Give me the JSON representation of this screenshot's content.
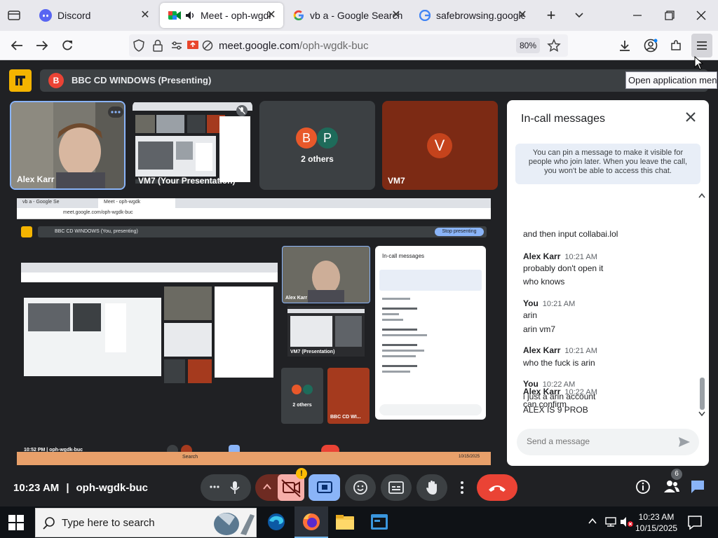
{
  "browser": {
    "tabs": [
      {
        "title": "Discord",
        "active": false
      },
      {
        "title": "Meet - oph-wgdk-buc",
        "active": true
      },
      {
        "title": "vb a - Google Search",
        "active": false
      },
      {
        "title": "safebrowsing.google.co",
        "active": false
      }
    ],
    "url_host": "meet.google.com",
    "url_path": "/oph-wgdk-buc",
    "zoom": "80%",
    "tooltip": "Open application menu"
  },
  "meet": {
    "presenting_banner": "BBC CD WINDOWS (Presenting)",
    "presenter_initial": "B",
    "tiles": [
      {
        "name": "Alex Karr"
      },
      {
        "name": "VM7 (Your Presentation)"
      },
      {
        "name": "2 others",
        "initials": [
          "B",
          "P"
        ]
      },
      {
        "name": "VM7",
        "initial": "V"
      }
    ],
    "inner_screen": {
      "tab1": "vb a - Google Se",
      "tab2": "Meet - oph-wgdk",
      "url": "meet.google.com/oph-wgdk-buc",
      "banner": "BBC CD WINDOWS (You, presenting)",
      "stop_button": "Stop presenting",
      "chat_title": "In-call messages",
      "footer": "10:52 PM  |  oph-wgdk-buc",
      "tile_alex": "Alex Karr",
      "tile_vm7": "VM7 (Presentation)",
      "tile_others": "2 others",
      "tile_bbc": "BBC CD WI...",
      "taskbar_search": "Search",
      "date": "10/15/2025"
    },
    "chat": {
      "title": "In-call messages",
      "info": "You can pin a message to make it visible for people who join later. When you leave the call, you won't be able to access this chat.",
      "messages": [
        {
          "sender": "",
          "time": "",
          "lines": [
            "and then input collabai.lol"
          ]
        },
        {
          "sender": "Alex Karr",
          "time": "10:21 AM",
          "lines": [
            "probably don't open it",
            "who knows"
          ]
        },
        {
          "sender": "You",
          "time": "10:21 AM",
          "lines": [
            "arin",
            "arin vm7"
          ]
        },
        {
          "sender": "Alex Karr",
          "time": "10:21 AM",
          "lines": [
            "who the fuck is arin"
          ]
        },
        {
          "sender": "You",
          "time": "10:22 AM",
          "lines": [
            "i just a arin account",
            "ALEX IS 9 PROB"
          ]
        },
        {
          "sender": "Alex Karr",
          "time": "10:22 AM",
          "lines": [
            "can confirm"
          ]
        }
      ],
      "input_placeholder": "Send a message"
    },
    "controls": {
      "time": "10:23 AM",
      "meeting_code": "oph-wgdk-buc",
      "people_count": "6"
    }
  },
  "taskbar": {
    "search_placeholder": "Type here to search",
    "time": "10:23 AM",
    "date": "10/15/2025"
  }
}
